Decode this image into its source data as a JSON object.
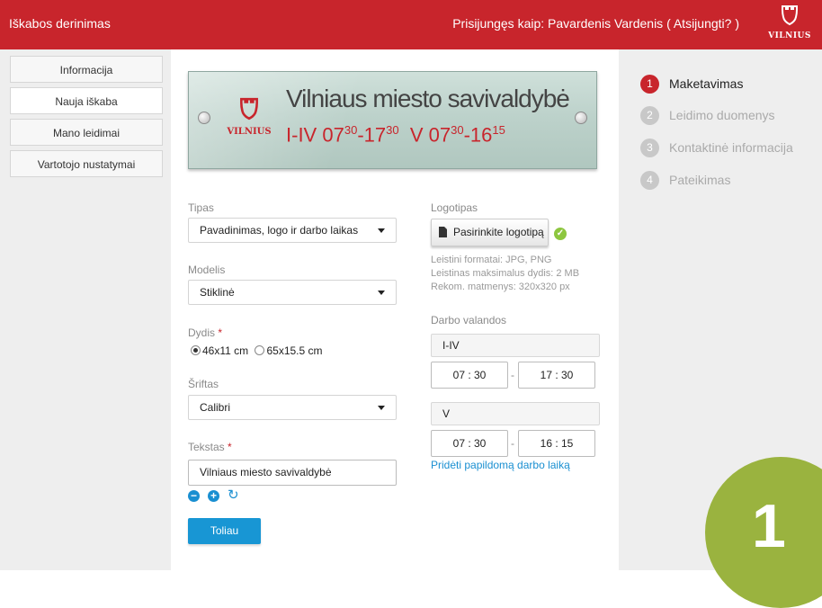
{
  "header": {
    "title": "Iškabos derinimas",
    "login_text": "Prisijungęs kaip: Pavardenis Vardenis ( Atsijungti? )",
    "logo_text": "VILNIUS"
  },
  "sidebar": {
    "items": [
      {
        "label": "Informacija"
      },
      {
        "label": "Nauja iškaba"
      },
      {
        "label": "Mano leidimai"
      },
      {
        "label": "Vartotojo nustatymai"
      }
    ]
  },
  "preview": {
    "logo_text": "VILNIUS",
    "title": "Vilniaus miesto savivaldybė",
    "hours": [
      {
        "days": "I-IV",
        "from_h": "07",
        "from_m": "30",
        "to_h": "17",
        "to_m": "30"
      },
      {
        "days": "V",
        "from_h": "07",
        "from_m": "30",
        "to_h": "16",
        "to_m": "15"
      }
    ]
  },
  "form": {
    "type_label": "Tipas",
    "type_value": "Pavadinimas, logo ir darbo laikas",
    "model_label": "Modelis",
    "model_value": "Stiklinė",
    "size_label": "Dydis",
    "required_mark": "*",
    "size_options": [
      {
        "label": "46x11 cm",
        "checked": true
      },
      {
        "label": "65x15.5 cm",
        "checked": false
      }
    ],
    "font_label": "Šriftas",
    "font_value": "Calibri",
    "text_label": "Tekstas",
    "text_value": "Vilniaus miesto savivaldybė",
    "next_button": "Toliau"
  },
  "logo_section": {
    "label": "Logotipas",
    "button": "Pasirinkite logotipą",
    "hints": [
      "Leistini formatai: JPG, PNG",
      "Leistinas maksimalus dydis: 2 MB",
      "Rekom. matmenys: 320x320 px"
    ]
  },
  "hours_section": {
    "label": "Darbo valandos",
    "rows": [
      {
        "day": "I-IV",
        "from": "07 : 30",
        "to": "17 : 30"
      },
      {
        "day": "V",
        "from": "07 : 30",
        "to": "16 : 15"
      }
    ],
    "separator": "-",
    "add_link": "Pridėti papildomą darbo laiką"
  },
  "steps": {
    "items": [
      {
        "num": "1",
        "label": "Maketavimas",
        "active": true
      },
      {
        "num": "2",
        "label": "Leidimo duomenys",
        "active": false
      },
      {
        "num": "3",
        "label": "Kontaktinė informacija",
        "active": false
      },
      {
        "num": "4",
        "label": "Pateikimas",
        "active": false
      }
    ],
    "current_big": "1"
  },
  "colors": {
    "brand_red": "#c8252c",
    "link_blue": "#1a8fd1",
    "step_green": "#9ab33f",
    "check_green": "#8dc63f"
  }
}
